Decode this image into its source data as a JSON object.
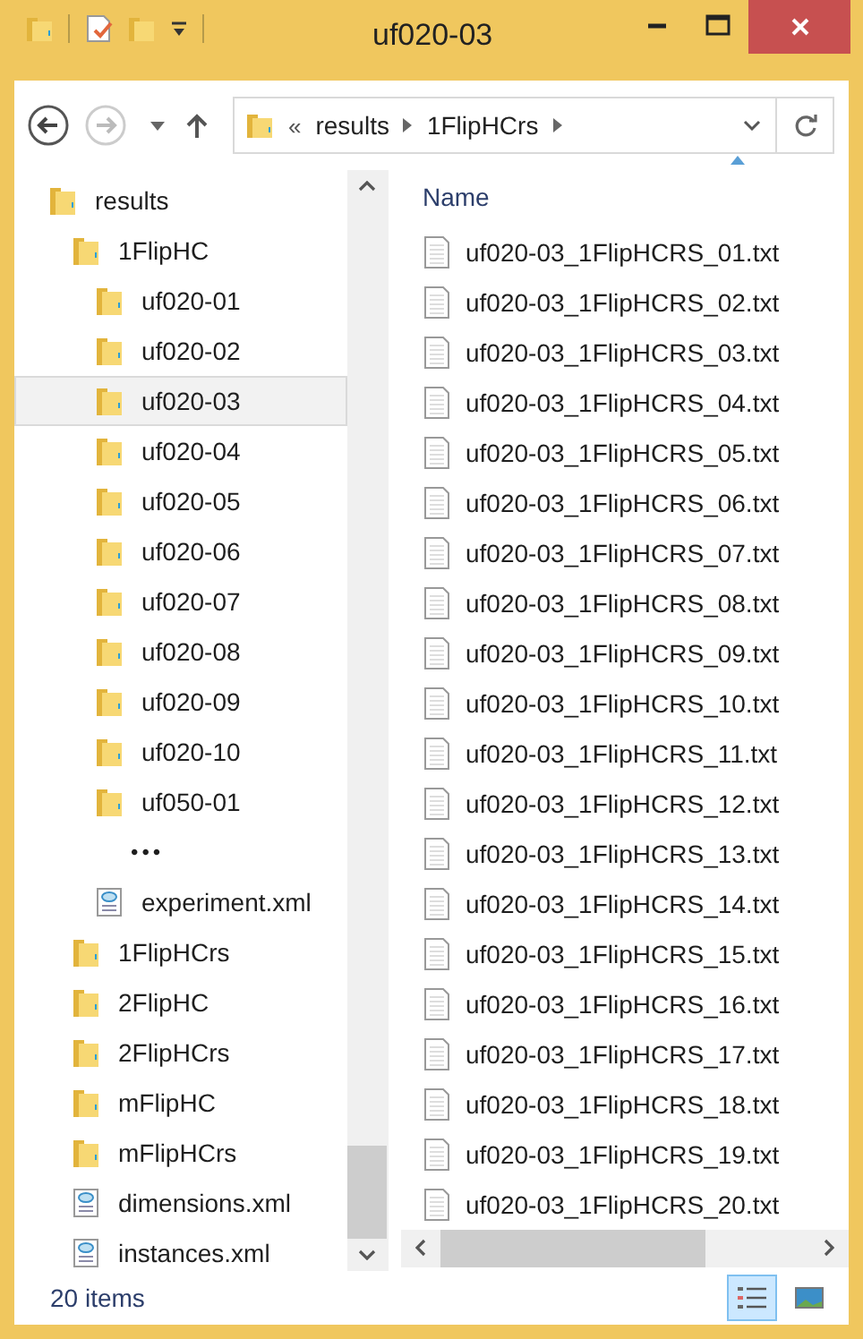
{
  "window": {
    "title": "uf020-03"
  },
  "address": {
    "overflow": "«",
    "crumbs": [
      "results",
      "1FlipHCrs"
    ]
  },
  "navigation": {
    "items": [
      {
        "label": "results",
        "kind": "folder",
        "selected": false,
        "children": [
          {
            "label": "1FlipHC",
            "kind": "folder",
            "selected": false,
            "children": [
              {
                "label": "uf020-01",
                "kind": "folder",
                "selected": false
              },
              {
                "label": "uf020-02",
                "kind": "folder",
                "selected": false
              },
              {
                "label": "uf020-03",
                "kind": "folder",
                "selected": true
              },
              {
                "label": "uf020-04",
                "kind": "folder",
                "selected": false
              },
              {
                "label": "uf020-05",
                "kind": "folder",
                "selected": false
              },
              {
                "label": "uf020-06",
                "kind": "folder",
                "selected": false
              },
              {
                "label": "uf020-07",
                "kind": "folder",
                "selected": false
              },
              {
                "label": "uf020-08",
                "kind": "folder",
                "selected": false
              },
              {
                "label": "uf020-09",
                "kind": "folder",
                "selected": false
              },
              {
                "label": "uf020-10",
                "kind": "folder",
                "selected": false
              },
              {
                "label": "uf050-01",
                "kind": "folder",
                "selected": false
              },
              {
                "label": "•••",
                "kind": "more",
                "selected": false
              },
              {
                "label": "experiment.xml",
                "kind": "xml",
                "selected": false
              }
            ]
          },
          {
            "label": "1FlipHCrs",
            "kind": "folder",
            "selected": false
          },
          {
            "label": "2FlipHC",
            "kind": "folder",
            "selected": false
          },
          {
            "label": "2FlipHCrs",
            "kind": "folder",
            "selected": false
          },
          {
            "label": "mFlipHC",
            "kind": "folder",
            "selected": false
          },
          {
            "label": "mFlipHCrs",
            "kind": "folder",
            "selected": false
          },
          {
            "label": "dimensions.xml",
            "kind": "xml",
            "selected": false
          },
          {
            "label": "instances.xml",
            "kind": "xml",
            "selected": false
          }
        ]
      }
    ]
  },
  "file_list": {
    "columns": [
      {
        "label": "Name",
        "sort_ascending": true
      }
    ],
    "files": [
      {
        "name": "uf020-03_1FlipHCRS_01.txt",
        "selected": false
      },
      {
        "name": "uf020-03_1FlipHCRS_02.txt",
        "selected": false
      },
      {
        "name": "uf020-03_1FlipHCRS_03.txt",
        "selected": false
      },
      {
        "name": "uf020-03_1FlipHCRS_04.txt",
        "selected": false
      },
      {
        "name": "uf020-03_1FlipHCRS_05.txt",
        "selected": false
      },
      {
        "name": "uf020-03_1FlipHCRS_06.txt",
        "selected": false
      },
      {
        "name": "uf020-03_1FlipHCRS_07.txt",
        "selected": false
      },
      {
        "name": "uf020-03_1FlipHCRS_08.txt",
        "selected": false
      },
      {
        "name": "uf020-03_1FlipHCRS_09.txt",
        "selected": false
      },
      {
        "name": "uf020-03_1FlipHCRS_10.txt",
        "selected": false
      },
      {
        "name": "uf020-03_1FlipHCRS_11.txt",
        "selected": false
      },
      {
        "name": "uf020-03_1FlipHCRS_12.txt",
        "selected": false
      },
      {
        "name": "uf020-03_1FlipHCRS_13.txt",
        "selected": false
      },
      {
        "name": "uf020-03_1FlipHCRS_14.txt",
        "selected": false
      },
      {
        "name": "uf020-03_1FlipHCRS_15.txt",
        "selected": false
      },
      {
        "name": "uf020-03_1FlipHCRS_16.txt",
        "selected": false
      },
      {
        "name": "uf020-03_1FlipHCRS_17.txt",
        "selected": false
      },
      {
        "name": "uf020-03_1FlipHCRS_18.txt",
        "selected": false
      },
      {
        "name": "uf020-03_1FlipHCRS_19.txt",
        "selected": false
      },
      {
        "name": "uf020-03_1FlipHCRS_20.txt",
        "selected": false
      }
    ]
  },
  "status_bar": {
    "text": "20 items",
    "views": [
      {
        "kind": "details",
        "selected": true
      },
      {
        "kind": "thumbnails",
        "selected": false
      }
    ]
  }
}
